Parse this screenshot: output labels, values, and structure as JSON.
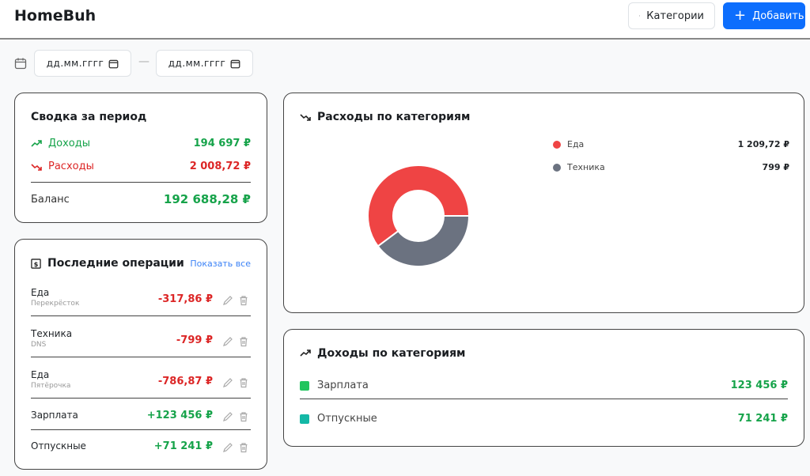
{
  "header": {
    "brand": "HomeBuh",
    "categories_label": "Категории",
    "add_label": "Добавить"
  },
  "filters": {
    "date_from_placeholder": "дд.мм.гггг",
    "date_to_placeholder": "дд.мм.гггг",
    "separator": "—"
  },
  "summary": {
    "title": "Сводка за период",
    "income_label": "Доходы",
    "income_value": "194 697 ₽",
    "expense_label": "Расходы",
    "expense_value": "2 008,72 ₽",
    "balance_label": "Баланс",
    "balance_value": "192 688,28 ₽"
  },
  "recent": {
    "title": "Последние операции",
    "show_all": "Показать все",
    "items": [
      {
        "name": "Еда",
        "sub": "Перекрёсток",
        "amount": "-317,86 ₽",
        "type": "expense"
      },
      {
        "name": "Техника",
        "sub": "DNS",
        "amount": "-799 ₽",
        "type": "expense"
      },
      {
        "name": "Еда",
        "sub": "Пятёрочка",
        "amount": "-786,87 ₽",
        "type": "expense"
      },
      {
        "name": "Зарплата",
        "sub": "",
        "amount": "+123 456 ₽",
        "type": "income"
      },
      {
        "name": "Отпускные",
        "sub": "",
        "amount": "+71 241 ₽",
        "type": "income"
      }
    ]
  },
  "expenses": {
    "title": "Расходы по категориям",
    "items": [
      {
        "name": "Еда",
        "value": "1 209,72 ₽",
        "color": "#ef4444"
      },
      {
        "name": "Техника",
        "value": "799 ₽",
        "color": "#6b7280"
      }
    ]
  },
  "chart_data": {
    "type": "pie",
    "variant": "doughnut",
    "categories": [
      "Еда",
      "Техника"
    ],
    "values": [
      1209.72,
      799
    ],
    "colors": [
      "#ef4444",
      "#6b7280"
    ]
  },
  "incomes": {
    "title": "Доходы по категориям",
    "items": [
      {
        "name": "Зарплата",
        "value": "123 456 ₽",
        "color": "#22c55e"
      },
      {
        "name": "Отпускные",
        "value": "71 241 ₽",
        "color": "#14b8a6"
      }
    ]
  }
}
